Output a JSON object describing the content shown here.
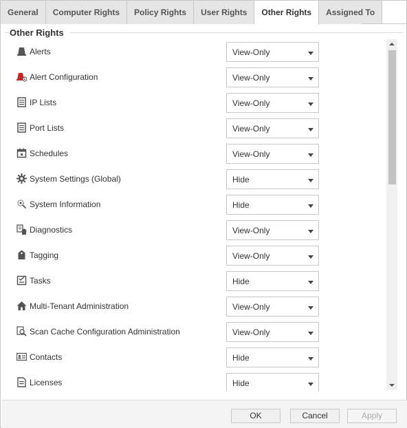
{
  "tabs": [
    {
      "label": "General",
      "active": false
    },
    {
      "label": "Computer Rights",
      "active": false
    },
    {
      "label": "Policy Rights",
      "active": false
    },
    {
      "label": "User Rights",
      "active": false
    },
    {
      "label": "Other Rights",
      "active": true
    },
    {
      "label": "Assigned To",
      "active": false
    }
  ],
  "section": {
    "title": "Other Rights"
  },
  "rights": [
    {
      "label": "Alerts",
      "value": "View-Only",
      "icon": "alert-bell-icon"
    },
    {
      "label": "Alert Configuration",
      "value": "View-Only",
      "icon": "alert-config-icon"
    },
    {
      "label": "IP Lists",
      "value": "View-Only",
      "icon": "list-document-icon"
    },
    {
      "label": "Port Lists",
      "value": "View-Only",
      "icon": "list-document-icon"
    },
    {
      "label": "Schedules",
      "value": "View-Only",
      "icon": "calendar-icon"
    },
    {
      "label": "System Settings (Global)",
      "value": "Hide",
      "icon": "gear-icon"
    },
    {
      "label": "System Information",
      "value": "Hide",
      "icon": "system-info-icon"
    },
    {
      "label": "Diagnostics",
      "value": "View-Only",
      "icon": "diagnostics-icon"
    },
    {
      "label": "Tagging",
      "value": "View-Only",
      "icon": "tag-icon"
    },
    {
      "label": "Tasks",
      "value": "Hide",
      "icon": "task-checklist-icon"
    },
    {
      "label": "Multi-Tenant Administration",
      "value": "View-Only",
      "icon": "house-icon"
    },
    {
      "label": "Scan Cache Configuration Administration",
      "value": "View-Only",
      "icon": "scan-cache-icon"
    },
    {
      "label": "Contacts",
      "value": "Hide",
      "icon": "contact-card-icon"
    },
    {
      "label": "Licenses",
      "value": "Hide",
      "icon": "license-document-icon"
    }
  ],
  "footer": {
    "ok_label": "OK",
    "cancel_label": "Cancel",
    "apply_label": "Apply"
  },
  "colors": {
    "alert_accent": "#cc2222",
    "icon_gray": "#555555",
    "tab_inactive_bg": "#e6e6e6"
  }
}
